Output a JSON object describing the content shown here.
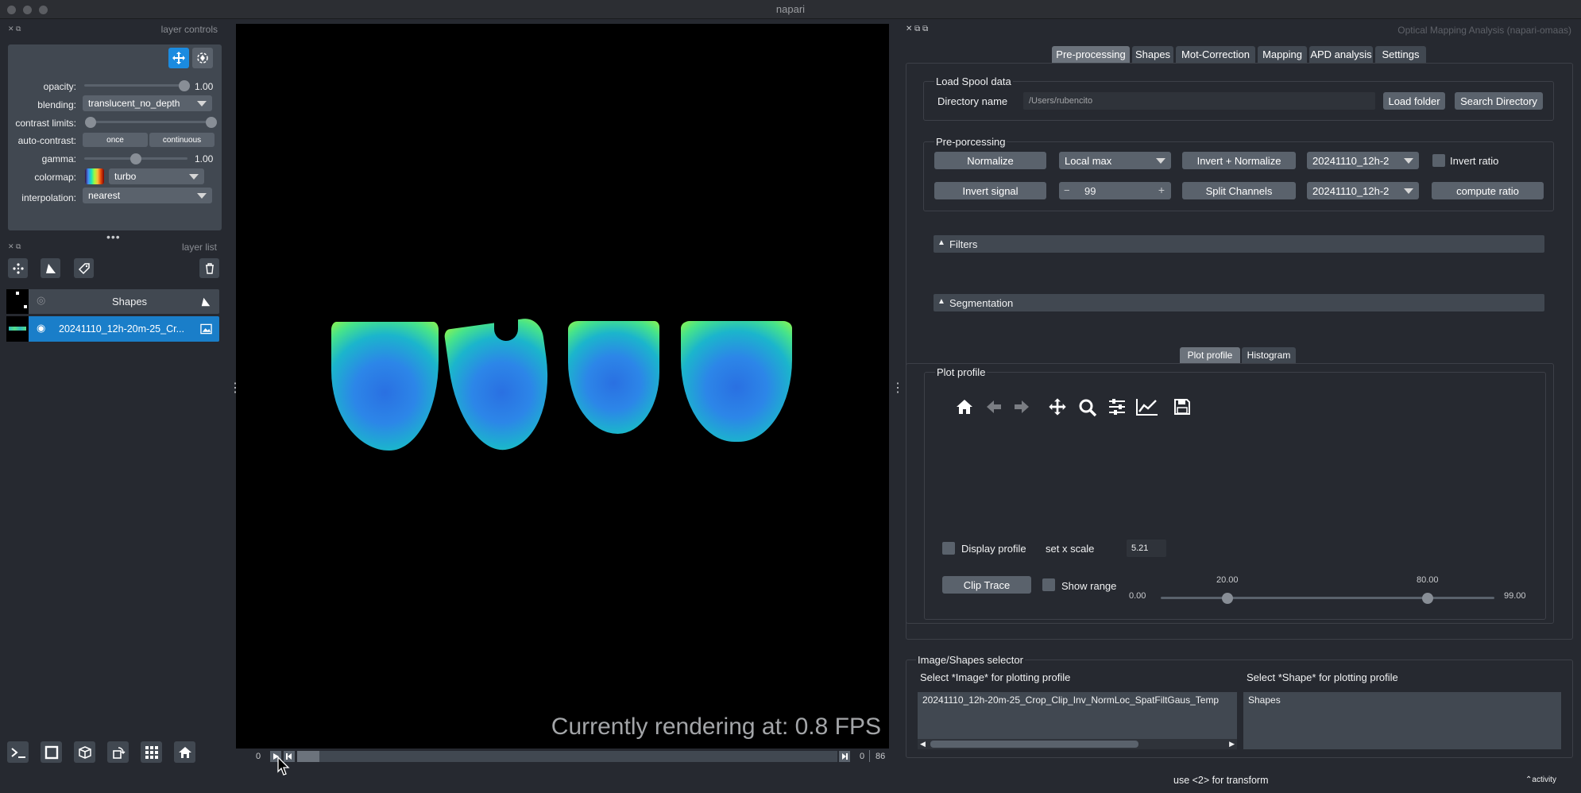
{
  "window": {
    "title": "napari"
  },
  "layer_controls": {
    "header": "layer controls",
    "opacity_label": "opacity:",
    "opacity_value": "1.00",
    "opacity_level": 0.97,
    "blending_label": "blending:",
    "blending_value": "translucent_no_depth",
    "contrast_label": "contrast limits:",
    "autocontrast_label": "auto-contrast:",
    "once_label": "once",
    "continuous_label": "continuous",
    "gamma_label": "gamma:",
    "gamma_value": "1.00",
    "gamma_level": 0.5,
    "colormap_label": "colormap:",
    "colormap_value": "turbo",
    "interpolation_label": "interpolation:",
    "interpolation_value": "nearest"
  },
  "layer_list": {
    "header": "layer list",
    "layers": [
      {
        "name": "Shapes",
        "visible": false,
        "selected": false
      },
      {
        "name": "20241110_12h-20m-25_Cr...",
        "visible": true,
        "selected": true
      }
    ]
  },
  "canvas": {
    "fps_text": "Currently rendering at: 0.8 FPS",
    "frame_start": "0",
    "frame_current": "0",
    "frame_total": "86"
  },
  "plugin": {
    "title": "Optical Mapping Analysis (napari-omaas)",
    "tabs": [
      "Pre-processing",
      "Shapes",
      "Mot-Correction",
      "Mapping",
      "APD analysis",
      "Settings"
    ],
    "active_tab": "Pre-processing",
    "load_spool": {
      "title": "Load Spool data",
      "dir_label": "Directory name",
      "dir_value": "/Users/rubencito",
      "load_button": "Load folder",
      "search_button": "Search Directory"
    },
    "preprocessing": {
      "title": "Pre-porcessing",
      "normalize": "Normalize",
      "local_max": "Local max",
      "invert_normalize": "Invert + Normalize",
      "select1": "20241110_12h-2",
      "invert_ratio": "Invert ratio",
      "invert_signal": "Invert signal",
      "spin_value": "99",
      "split_channels": "Split Channels",
      "select2": "20241110_12h-2",
      "compute_ratio": "compute ratio"
    },
    "filters_label": "Filters",
    "segmentation_label": "Segmentation",
    "plot_tabs": [
      "Plot profile",
      "Histogram"
    ],
    "plot_profile": {
      "title": "Plot profile",
      "display_profile": "Display profile",
      "set_x_scale": "set x scale",
      "x_scale_value": "5.21",
      "clip_trace": "Clip Trace",
      "show_range": "Show range",
      "range_min": "0.00",
      "range_max": "99.00",
      "low_value": "20.00",
      "high_value": "80.00",
      "low_level": 0.2,
      "high_level": 0.8
    },
    "selector": {
      "title": "Image/Shapes selector",
      "image_label": "Select *Image* for plotting profile",
      "shape_label": "Select *Shape* for plotting profile",
      "image_item": "20241110_12h-20m-25_Crop_Clip_Inv_NormLoc_SpatFiltGaus_Temp",
      "shape_item": "Shapes"
    }
  },
  "status": {
    "hint": "use <2> for transform",
    "activity": "activity"
  }
}
